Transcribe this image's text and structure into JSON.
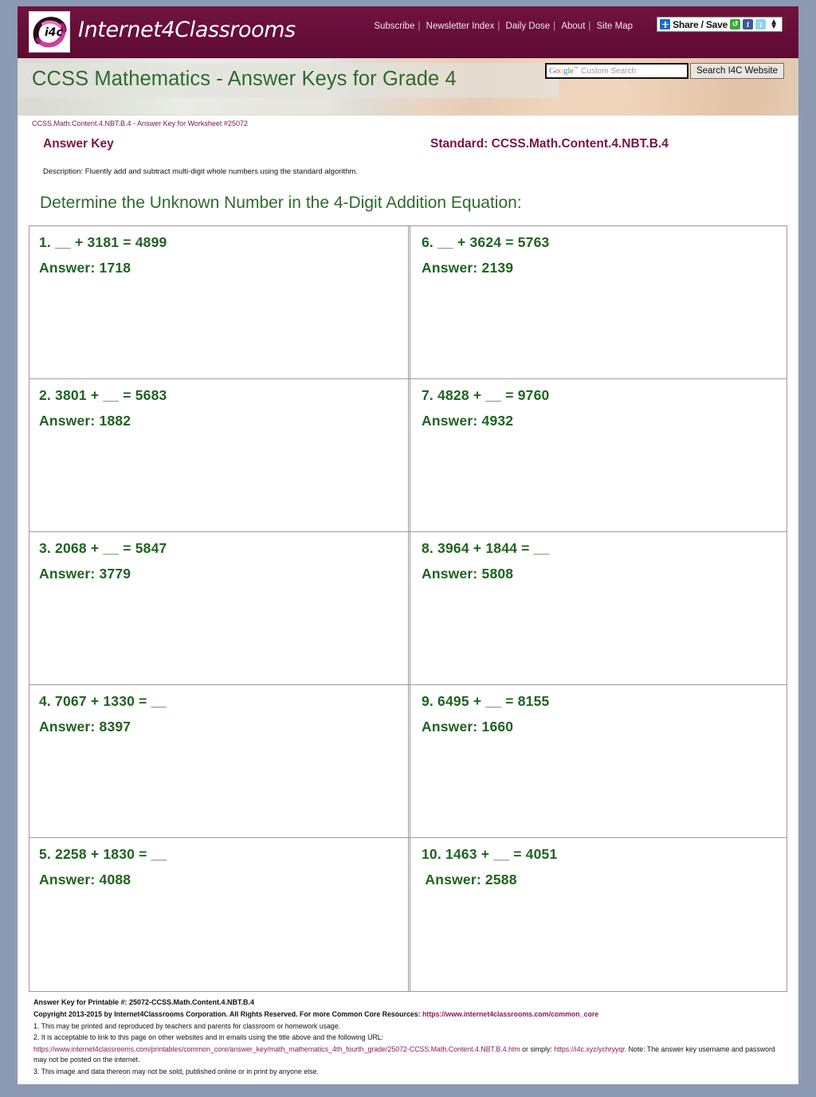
{
  "site": {
    "logo_text": "Internet4Classrooms",
    "logo_badge": "i4c",
    "nav": [
      {
        "label": "Subscribe"
      },
      {
        "label": "Newsletter Index"
      },
      {
        "label": "Daily Dose"
      },
      {
        "label": "About"
      },
      {
        "label": "Site Map"
      }
    ],
    "share": {
      "label": "Share / Save",
      "icons": [
        "plus-icon",
        "share-green-icon",
        "facebook-icon",
        "twitter-icon",
        "updown-arrows-icon"
      ]
    },
    "search": {
      "google_word": "Google",
      "trademark": "™",
      "placeholder": "Custom Search",
      "value": "",
      "button_label": "Search I4C Website"
    }
  },
  "banner": {
    "title": "CCSS Mathematics - Answer Keys for Grade 4"
  },
  "breadcrumb": "CCSS.Math.Content.4.NBT.B.4 - Answer Key for Worksheet #25072",
  "header": {
    "answer_key_label": "Answer Key",
    "standard_label": "Standard: CCSS.Math.Content.4.NBT.B.4",
    "description": "Description: Fluently add and subtract multi-digit whole numbers using the standard algorithm."
  },
  "instruction": "Determine the Unknown Number in the 4-Digit Addition Equation:",
  "problems": [
    {
      "question": "1. __ + 3181 = 4899",
      "answer": "Answer: 1718"
    },
    {
      "question": "6. __ + 3624 = 5763",
      "answer": "Answer: 2139"
    },
    {
      "question": "2. 3801 + __ = 5683",
      "answer": "Answer: 1882"
    },
    {
      "question": "7. 4828 + __ = 9760",
      "answer": "Answer: 4932"
    },
    {
      "question": "3. 2068 + __ = 5847",
      "answer": "Answer: 3779"
    },
    {
      "question": "8. 3964 + 1844 = __",
      "answer": "Answer: 5808"
    },
    {
      "question": "4. 7067 + 1330 = __",
      "answer": "Answer: 8397"
    },
    {
      "question": "9. 6495 + __ = 8155",
      "answer": "Answer: 1660"
    },
    {
      "question": "5. 2258 + 1830 = __",
      "answer": "Answer: 4088"
    },
    {
      "question": "10. 1463 + __ = 4051",
      "answer": " Answer: 2588"
    }
  ],
  "footer": {
    "printable_line": "Answer Key for Printable #: 25072-CCSS.Math.Content.4.NBT.B.4",
    "copyright_prefix": "Copyright 2013-2015 by Internet4Classrooms Corporation. All Rights Reserved. For more Common Core Resources: ",
    "copyright_link": "https://www.internet4classrooms.com/common_core",
    "note1": "1. This may be printed and reproduced by teachers and parents for classroom or homework usage.",
    "note2": "2. It is acceptable to link to this page on other websites and in emails using the title above and the following URL:",
    "note2_url": "https://www.internet4classrooms.com/printables/common_core/answer_key/math_mathematics_4th_fourth_grade/25072-CCSS.Math.Content.4.NBT.B.4.htm",
    "note2_mid": " or simply: ",
    "note2_short": "https://i4c.xyz/ychryyqr",
    "note2_tail": ". Note: The answer key username and password may not be posted on the internet.",
    "note3": "3. This image and data thereon may not be sold, published online or in print by anyone else."
  },
  "colors": {
    "maroon": "#6a0f3c",
    "green": "#2e6b2c",
    "problem_green": "#1f6320",
    "page_bg": "#8b9ab2",
    "link": "#8a1a4f"
  }
}
